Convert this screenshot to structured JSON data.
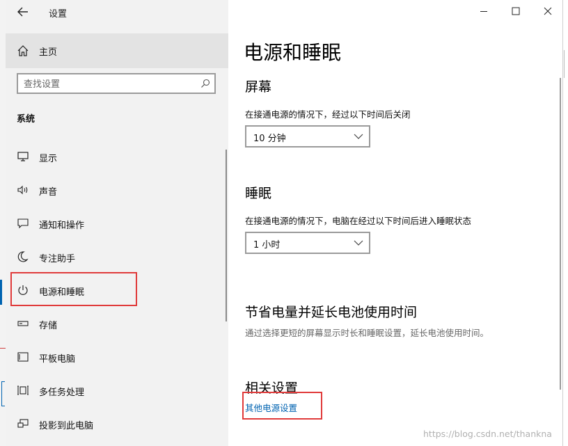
{
  "window": {
    "title": "设置",
    "home_label": "主页",
    "search_placeholder": "查找设置",
    "section_label": "系统"
  },
  "sidebar": {
    "items": [
      {
        "label": "显示",
        "icon": "display-icon"
      },
      {
        "label": "声音",
        "icon": "speaker-icon"
      },
      {
        "label": "通知和操作",
        "icon": "notification-icon"
      },
      {
        "label": "专注助手",
        "icon": "moon-icon"
      },
      {
        "label": "电源和睡眠",
        "icon": "power-icon"
      },
      {
        "label": "存储",
        "icon": "storage-icon"
      },
      {
        "label": "平板电脑",
        "icon": "tablet-icon"
      },
      {
        "label": "多任务处理",
        "icon": "multitask-icon"
      },
      {
        "label": "投影到此电脑",
        "icon": "project-icon"
      }
    ]
  },
  "main": {
    "title": "电源和睡眠",
    "screen": {
      "heading": "屏幕",
      "description": "在接通电源的情况下，经过以下时间后关闭",
      "selected": "10 分钟"
    },
    "sleep": {
      "heading": "睡眠",
      "description": "在接通电源的情况下，电脑在经过以下时间后进入睡眠状态",
      "selected": "1 小时"
    },
    "battery": {
      "heading": "节省电量并延长电池使用时间",
      "description": "通过选择更短的屏幕显示时长和睡眠设置，延长电池使用时间。"
    },
    "related": {
      "heading": "相关设置",
      "link": "其他电源设置"
    }
  },
  "watermark": "https://blog.csdn.net/thankna",
  "colors": {
    "accent": "#0063b1",
    "highlight_box": "#e03a3a",
    "sidebar_bg": "#f2f2f2"
  }
}
